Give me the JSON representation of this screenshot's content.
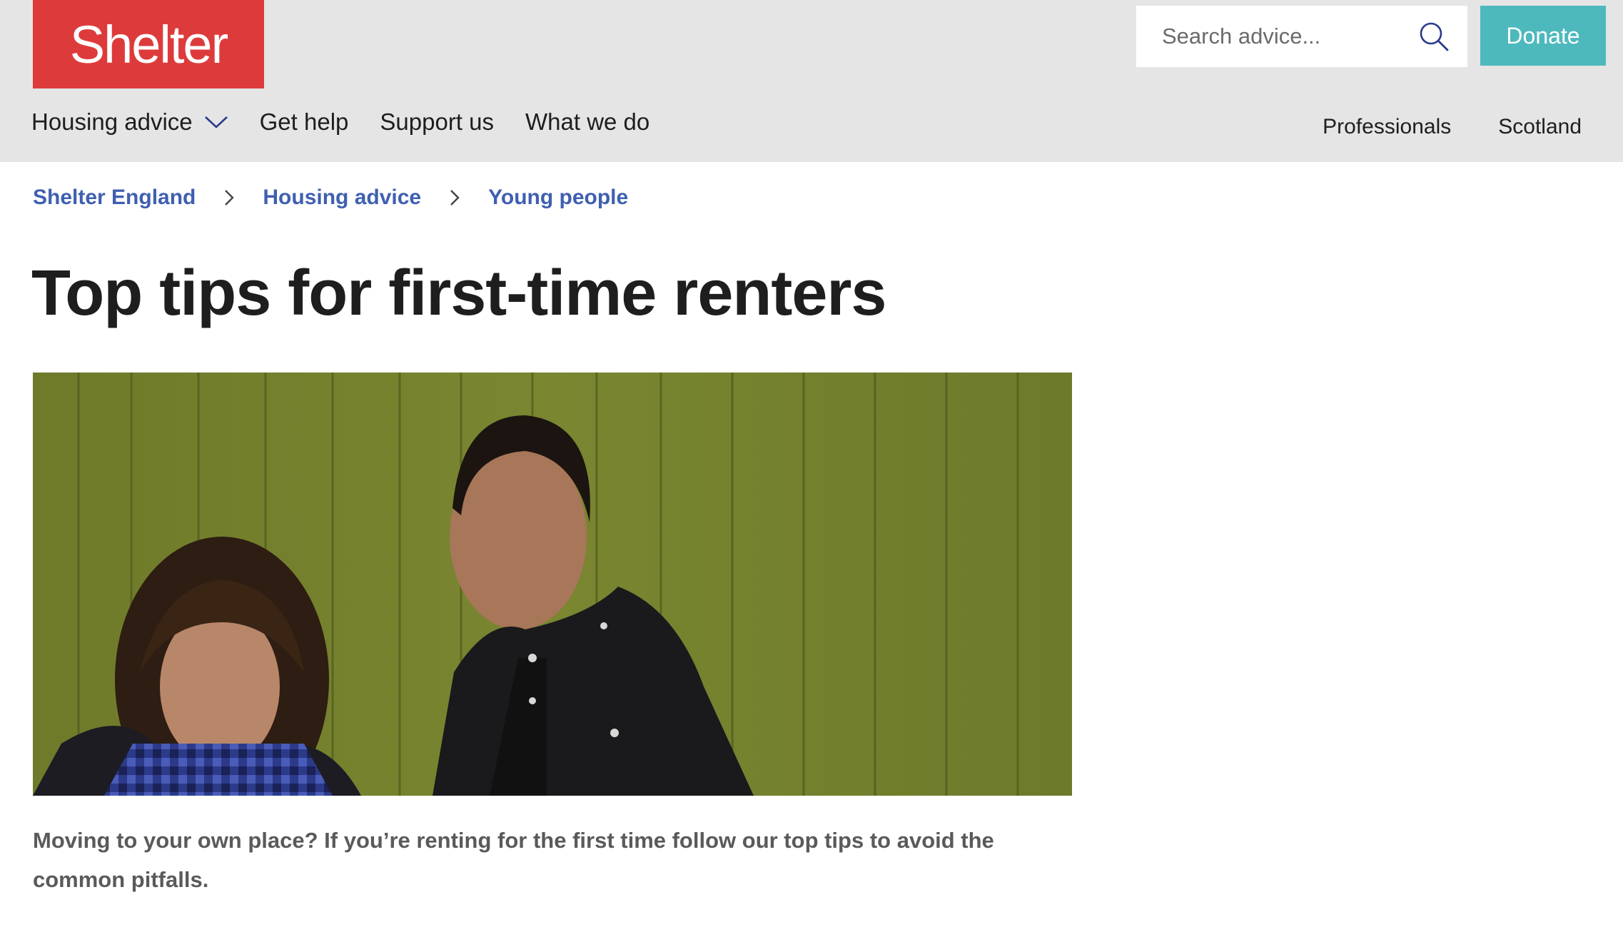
{
  "header": {
    "logo_text": "Shelter",
    "search_placeholder": "Search advice...",
    "donate_label": "Donate",
    "nav_left": [
      {
        "label": "Housing advice",
        "has_dropdown": true
      },
      {
        "label": "Get help"
      },
      {
        "label": "Support us"
      },
      {
        "label": "What we do"
      }
    ],
    "nav_right": [
      {
        "label": "Professionals"
      },
      {
        "label": "Scotland"
      }
    ]
  },
  "breadcrumb": [
    "Shelter England",
    "Housing advice",
    "Young people"
  ],
  "page_title": "Top tips for first-time renters",
  "intro_text": "Moving to your own place? If you’re renting for the first time follow our top tips to avoid the common pitfalls.",
  "colors": {
    "header_bg": "#e5e5e5",
    "logo_bg": "#dd3b3b",
    "donate_bg": "#4eb9bd",
    "link": "#3f5fb0",
    "title": "#1e1e1e",
    "intro": "#5a5a5a"
  },
  "icons": {
    "search": "search-icon",
    "dropdown": "chevron-down-icon",
    "breadcrumb_separator": "chevron-right-icon"
  }
}
